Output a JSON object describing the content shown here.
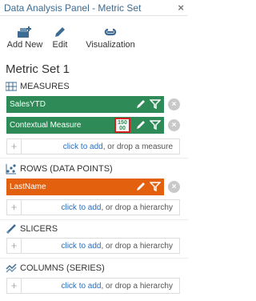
{
  "window": {
    "title": "Data Analysis Panel - Metric Set",
    "close_glyph": "×"
  },
  "toolbar": {
    "add_new": "Add New",
    "edit": "Edit",
    "visualization": "Visualization"
  },
  "metric_set_title": "Metric Set 1",
  "sections": {
    "measures": {
      "heading": "MEASURES",
      "fields": [
        {
          "label": "SalesYTD"
        },
        {
          "label": "Contextual Measure",
          "format_badge": "150\n00"
        }
      ],
      "drop_link": "click to add",
      "drop_rest": ", or drop a measure"
    },
    "rows": {
      "heading": "ROWS (DATA POINTS)",
      "fields": [
        {
          "label": "LastName"
        }
      ],
      "drop_link": "click to add",
      "drop_rest": ", or drop a hierarchy"
    },
    "slicers": {
      "heading": "SLICERS",
      "drop_link": "click to add",
      "drop_rest": ", or drop a hierarchy"
    },
    "columns": {
      "heading": "COLUMNS (SERIES)",
      "drop_link": "click to add",
      "drop_rest": ", or drop a hierarchy"
    }
  },
  "colors": {
    "measure": "#2e8b57",
    "hierarchy": "#e3600f",
    "highlight": "#d42020",
    "link": "#2a6ebb"
  },
  "icons": [
    "add-new-icon",
    "edit-icon",
    "visualization-icon",
    "pencil-icon",
    "filter-icon",
    "remove-icon",
    "format-icon"
  ]
}
